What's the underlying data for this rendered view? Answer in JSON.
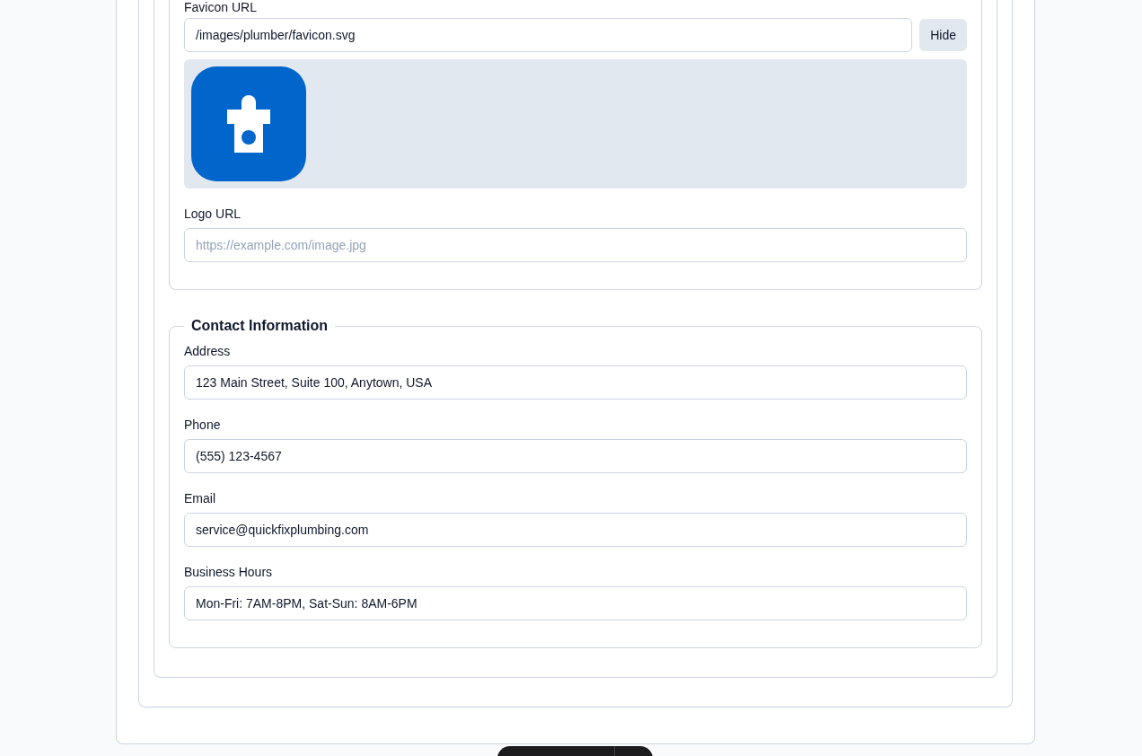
{
  "branding": {
    "favicon": {
      "label": "Favicon URL",
      "value": "/images/plumber/favicon.svg",
      "toggle_button": "Hide",
      "preview_shown": true
    },
    "logo": {
      "label": "Logo URL",
      "placeholder": "https://example.com/image.jpg"
    }
  },
  "contact": {
    "legend": "Contact Information",
    "fields": [
      {
        "label": "Address",
        "value": "123 Main Street, Suite 100, Anytown, USA"
      },
      {
        "label": "Phone",
        "value": "(555) 123-4567"
      },
      {
        "label": "Email",
        "value": "service@quickfixplumbing.com"
      },
      {
        "label": "Business Hours",
        "value": "Mon-Fri: 7AM-8PM, Sat-Sun: 8AM-6PM"
      }
    ]
  }
}
